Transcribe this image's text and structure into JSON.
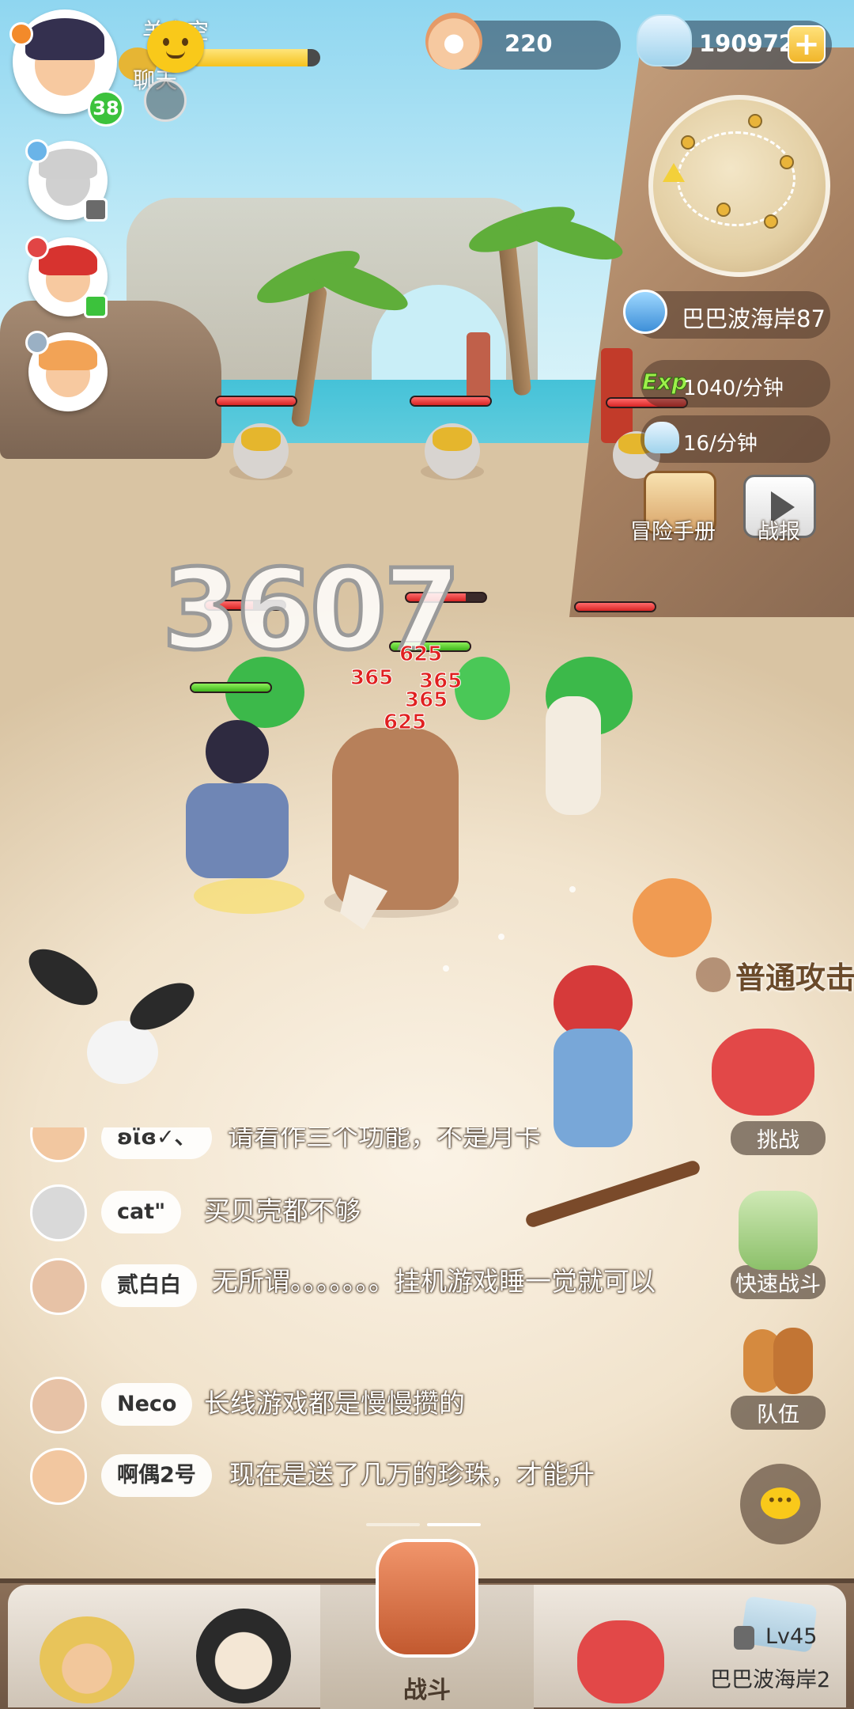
{
  "hud": {
    "player_name": "羊小空",
    "player_level": "38",
    "chat_label": "聊天",
    "pearl_count": "220",
    "gem_count": "190972",
    "plus_symbol": "+"
  },
  "damage": {
    "big_number": "3607",
    "hits": [
      "625",
      "365",
      "365",
      "365",
      "625"
    ]
  },
  "map": {
    "location": "巴巴波海岸87",
    "exp_label": "Exp",
    "exp_rate": "1040/分钟",
    "gem_rate": "16/分钟"
  },
  "buttons": {
    "adventure_manual": "冒险手册",
    "battle_report": "战报",
    "challenge": "挑战",
    "quick_battle": "快速战斗",
    "team": "队伍"
  },
  "skill_popup": "普通攻击",
  "chat": {
    "messages": [
      {
        "name": "ʚϊɞ✓、",
        "text": "请看作三个功能，不是月卡"
      },
      {
        "name": "cat\"",
        "text": "买贝壳都不够"
      },
      {
        "name": "贰白白",
        "text": "无所谓。。。。。。。挂机游戏睡一觉就可以"
      },
      {
        "name": "Neco",
        "text": "长线游戏都是慢慢攒的"
      },
      {
        "name": "啊偶2号",
        "text": "现在是送了几万的珍珠，才能升"
      }
    ]
  },
  "nav": {
    "battle": "战斗",
    "map_level": "Lv45",
    "map_name": "巴巴波海岸2"
  },
  "colors": {
    "accent_yellow": "#f9c91a",
    "hp_red": "#d82424",
    "hp_green": "#3fb51c",
    "exp_green": "#9df04a"
  }
}
